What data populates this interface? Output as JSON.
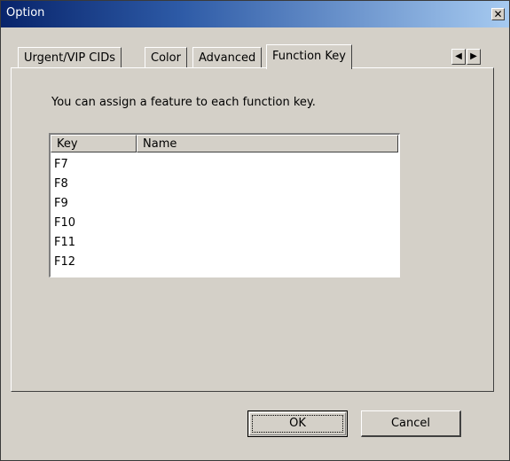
{
  "window": {
    "title": "Option",
    "close_glyph": "✕"
  },
  "tabs": [
    {
      "label": "Urgent/VIP CIDs",
      "active": false
    },
    {
      "label": "Color",
      "active": false
    },
    {
      "label": "Advanced",
      "active": false
    },
    {
      "label": "Function Key",
      "active": true
    }
  ],
  "tab_scroll": {
    "left_icon": "◀",
    "right_icon": "▶"
  },
  "panel": {
    "description": "You can assign a feature to each function key.",
    "list": {
      "columns": [
        "Key",
        "Name"
      ],
      "rows": [
        {
          "key": "F7",
          "name": ""
        },
        {
          "key": "F8",
          "name": ""
        },
        {
          "key": "F9",
          "name": ""
        },
        {
          "key": "F10",
          "name": ""
        },
        {
          "key": "F11",
          "name": ""
        },
        {
          "key": "F12",
          "name": ""
        }
      ]
    }
  },
  "buttons": {
    "ok": "OK",
    "cancel": "Cancel"
  }
}
